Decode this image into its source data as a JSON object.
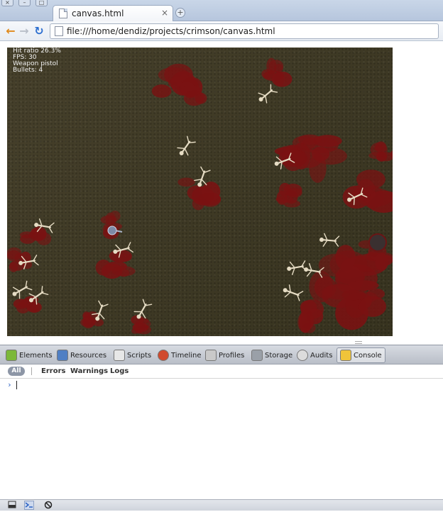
{
  "window": {
    "controls": [
      "×",
      "–",
      "□"
    ]
  },
  "tab": {
    "title": "canvas.html",
    "close": "×",
    "newtab": "+"
  },
  "toolbar": {
    "back": "←",
    "forward": "→",
    "reload": "↻",
    "url": "file:///home/dendiz/projects/crimson/canvas.html"
  },
  "game": {
    "hud": {
      "hit_ratio": "Hit ratio 26.3%",
      "fps": "FPS: 30",
      "weapon": "Weapon pistol",
      "bullets": "Bullets: 4"
    },
    "colors": {
      "ground": "#3f3b27",
      "blood": "#7a1212",
      "skeleton": "#e6dcc4",
      "enemy_blob": "#3a3030"
    }
  },
  "devtools": {
    "panels": [
      "Elements",
      "Resources",
      "Scripts",
      "Timeline",
      "Profiles",
      "Storage",
      "Audits",
      "Console"
    ],
    "active_panel": "Console",
    "filters": [
      "All",
      "Errors",
      "Warnings",
      "Logs"
    ],
    "prompt": "›",
    "status_icons": [
      "dock-icon",
      "console-icon",
      "clear-icon"
    ]
  }
}
